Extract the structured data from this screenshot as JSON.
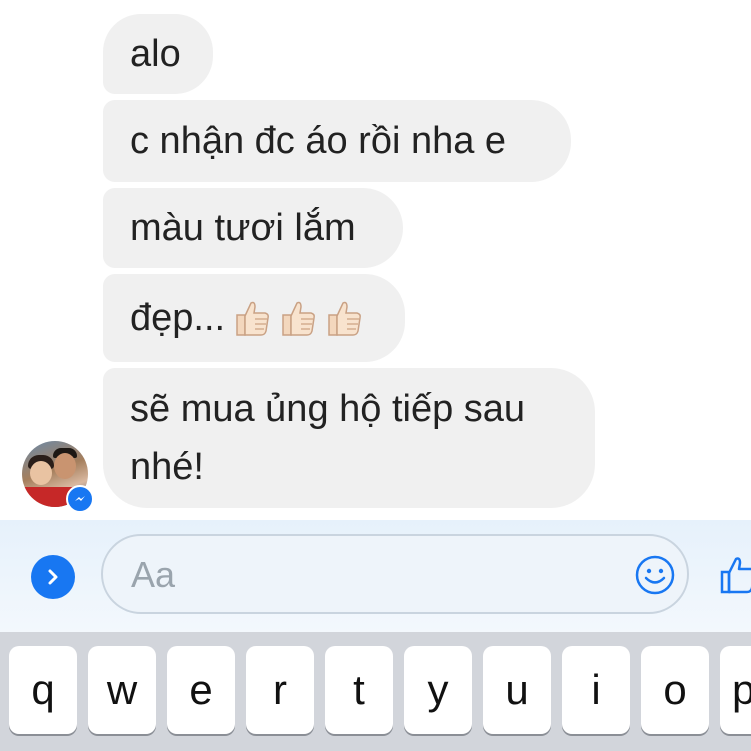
{
  "messages": [
    {
      "text": "alo"
    },
    {
      "text": "c nhận đc áo rồi nha e"
    },
    {
      "text": "màu tươi lắm"
    },
    {
      "text": "đẹp..."
    },
    {
      "text": "sẽ mua ủng hộ tiếp sau nhé!"
    }
  ],
  "emoji_after_msg4": [
    "thumbs-up-icon",
    "thumbs-up-icon",
    "thumbs-up-icon"
  ],
  "composer": {
    "placeholder": "Aa"
  },
  "keyboard": {
    "keys": [
      "q",
      "w",
      "e",
      "r",
      "t",
      "y",
      "u",
      "i",
      "o",
      "p"
    ]
  },
  "colors": {
    "bubble_bg": "#f0f0f0",
    "accent": "#1877f2",
    "composer_bg": "#e6f1fb",
    "keyboard_bg": "#d2d5db"
  },
  "icons": {
    "expand": "chevron-right-icon",
    "emoji": "smiley-icon",
    "send_like": "like-icon",
    "avatar_badge": "messenger-icon"
  }
}
